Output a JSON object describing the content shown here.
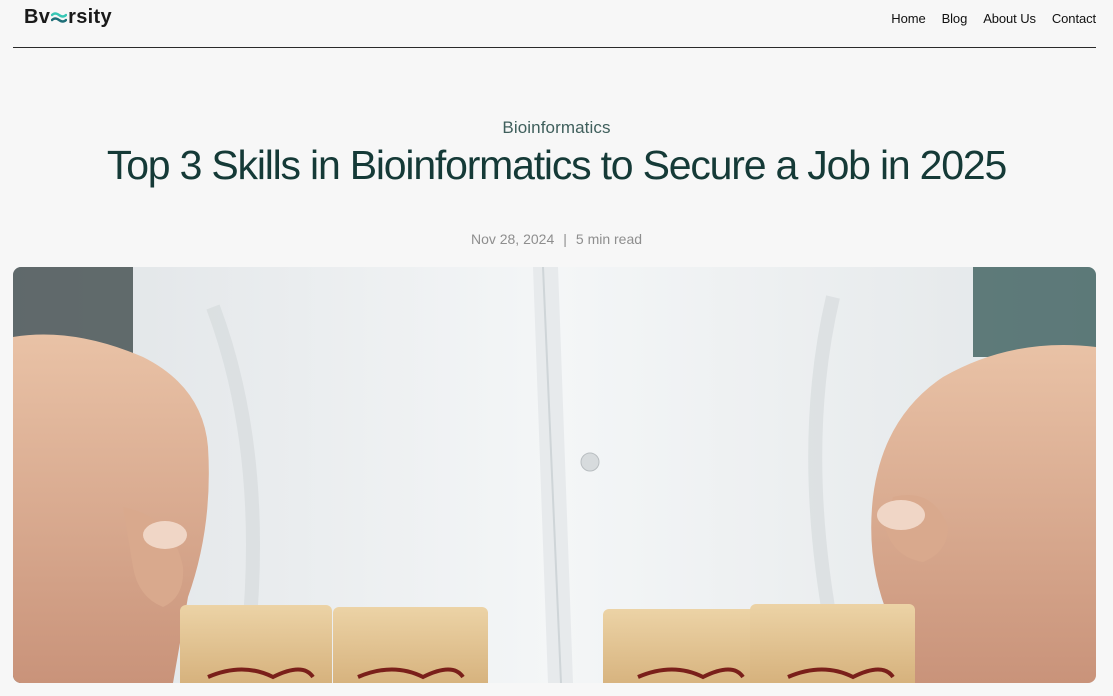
{
  "header": {
    "logo": {
      "prefix": "Bv",
      "suffix": "rsity"
    },
    "nav": [
      {
        "label": "Home"
      },
      {
        "label": "Blog"
      },
      {
        "label": "About Us"
      },
      {
        "label": "Contact"
      }
    ]
  },
  "article": {
    "category": "Bioinformatics",
    "title": "Top 3 Skills in Bioinformatics to Secure a Job in 2025",
    "date": "Nov 28, 2024",
    "separator": "|",
    "read_time": "5 min read"
  },
  "colors": {
    "background": "#f7f7f7",
    "title": "#153a37",
    "category": "#3f5f5c",
    "meta": "#8e8e8e",
    "logo_accent": "#38c7b5"
  }
}
